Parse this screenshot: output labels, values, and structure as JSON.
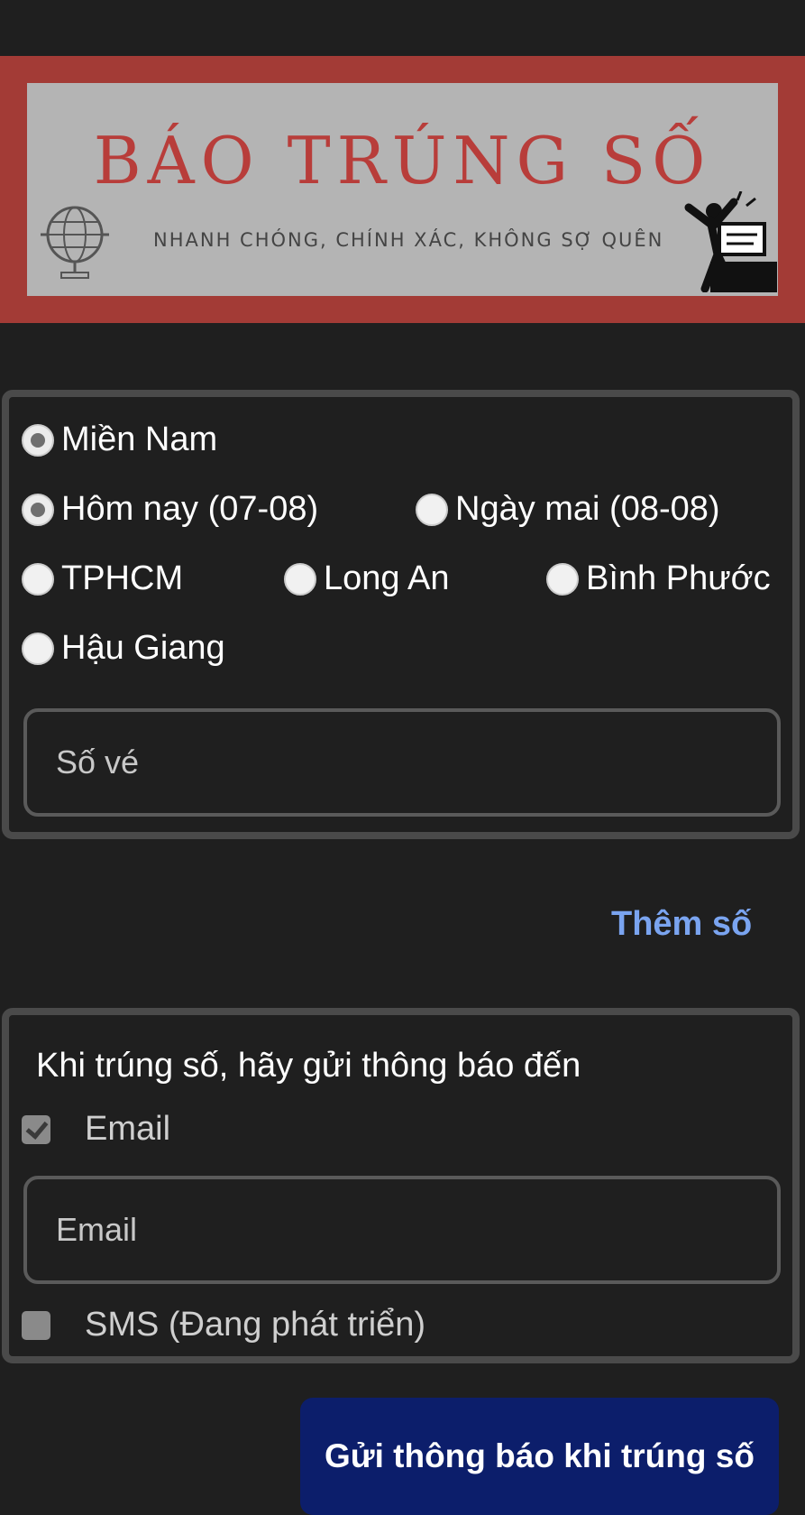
{
  "banner": {
    "title": "BÁO TRÚNG SỐ",
    "slogan": "NHANH CHÓNG, CHÍNH XÁC, KHÔNG SỢ QUÊN"
  },
  "selection": {
    "region": {
      "label": "Miền Nam",
      "checked": true
    },
    "dates": [
      {
        "label": "Hôm nay (07-08)",
        "checked": true
      },
      {
        "label": "Ngày mai (08-08)",
        "checked": false
      }
    ],
    "provinces": [
      {
        "label": "TPHCM",
        "checked": false
      },
      {
        "label": "Long An",
        "checked": false
      },
      {
        "label": "Bình Phước",
        "checked": false
      },
      {
        "label": "Hậu Giang",
        "checked": false
      }
    ],
    "ticket_placeholder": "Số vé"
  },
  "add_number_label": "Thêm số",
  "notify": {
    "title": "Khi trúng số, hãy gửi thông báo đến",
    "email_label": "Email",
    "email_checked": true,
    "email_placeholder": "Email",
    "sms_label": "SMS (Đang phát triển)",
    "sms_checked": false
  },
  "submit_label": "Gửi thông báo khi trúng số",
  "colors": {
    "background": "#1f1f1f",
    "banner_red": "#a33b36",
    "link_blue": "#7aa4f0",
    "button_navy": "#0c1e6b"
  }
}
